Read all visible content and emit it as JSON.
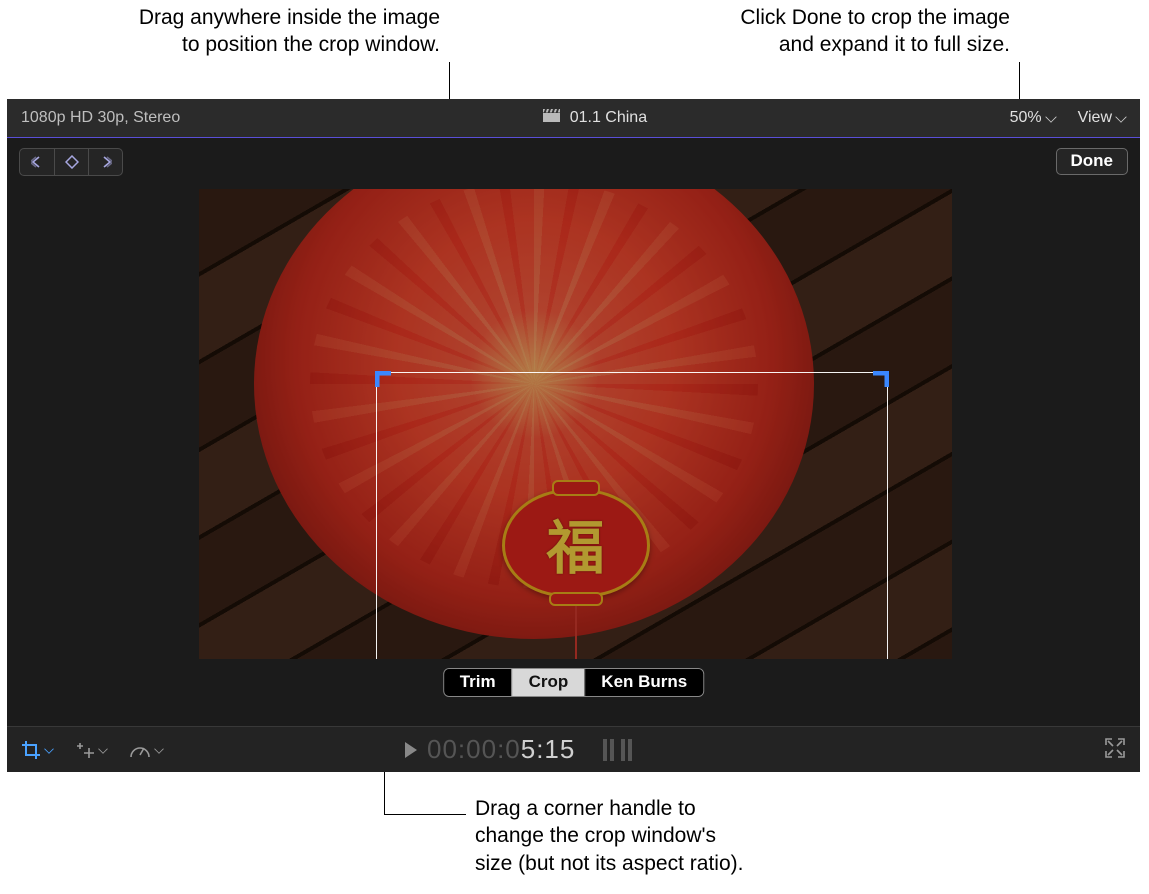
{
  "callouts": {
    "crop_position": "Drag anywhere inside the image\nto position the crop window.",
    "done_hint": "Click Done to crop the image\nand expand it to full size.",
    "corner_hint": "Drag a corner handle to\nchange the crop window's\nsize (but not its aspect ratio)."
  },
  "title_bar": {
    "format_info": "1080p HD 30p, Stereo",
    "clip_name": "01.1 China",
    "zoom_label": "50%",
    "view_label": "View"
  },
  "done_label": "Done",
  "mode_segments": {
    "trim": "Trim",
    "crop": "Crop",
    "ken_burns": "Ken Burns"
  },
  "timecode": {
    "dim": "00:00:0",
    "bright": "5:15"
  },
  "medallion_char": "福",
  "colors": {
    "handle_blue": "#3a87ff"
  }
}
